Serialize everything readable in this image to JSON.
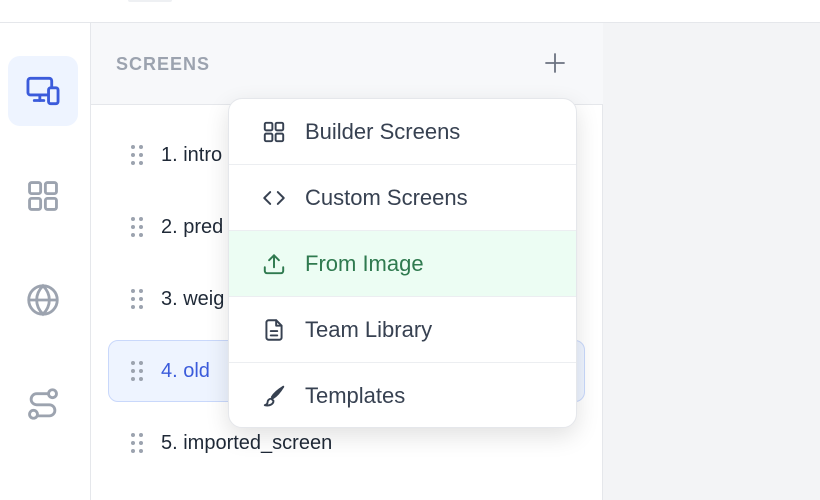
{
  "panel": {
    "title": "SCREENS"
  },
  "rail": {
    "items": [
      {
        "icon": "devices-icon",
        "active": true
      },
      {
        "icon": "grid-icon",
        "active": false
      },
      {
        "icon": "globe-icon",
        "active": false
      },
      {
        "icon": "flow-icon",
        "active": false
      }
    ]
  },
  "screens": [
    {
      "label": "1. intro"
    },
    {
      "label": "2. pred"
    },
    {
      "label": "3. weig"
    },
    {
      "label": "4. old",
      "selected": true
    },
    {
      "label": "5. imported_screen"
    }
  ],
  "menu": {
    "items": [
      {
        "label": "Builder Screens",
        "icon": "grid-icon"
      },
      {
        "label": "Custom Screens",
        "icon": "code-icon"
      },
      {
        "label": "From Image",
        "icon": "upload-icon",
        "highlighted": true
      },
      {
        "label": "Team Library",
        "icon": "document-icon"
      },
      {
        "label": "Templates",
        "icon": "brush-icon"
      }
    ]
  },
  "colors": {
    "accent": "#3b5bdb",
    "highlight_bg": "#ecfdf3",
    "highlight_text": "#2f7a4f"
  }
}
